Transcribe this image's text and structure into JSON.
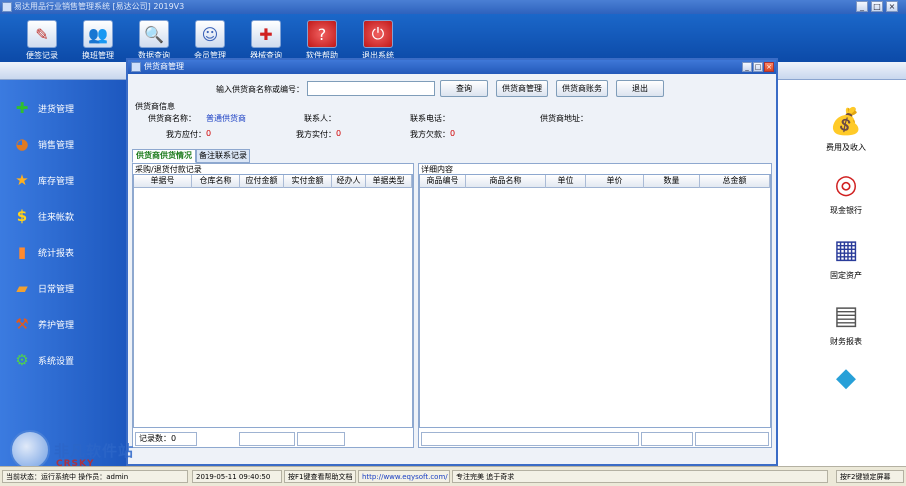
{
  "window": {
    "title": "易达用品行业销售管理系统 [易达公司] 2019V3",
    "controls": [
      "_",
      "□",
      "×"
    ]
  },
  "toolbar": [
    {
      "label": "便签记录",
      "icon": "notepad-icon"
    },
    {
      "label": "换班管理",
      "icon": "people-icon"
    },
    {
      "label": "数据查询",
      "icon": "magnifier-icon"
    },
    {
      "label": "会员管理",
      "icon": "members-icon"
    },
    {
      "label": "器械查询",
      "icon": "medical-kit-icon"
    },
    {
      "label": "软件帮助",
      "icon": "help-icon"
    },
    {
      "label": "退出系统",
      "icon": "power-icon"
    }
  ],
  "sidebar": [
    {
      "label": "进货管理",
      "icon": "plus-icon"
    },
    {
      "label": "销售管理",
      "icon": "pie-icon"
    },
    {
      "label": "库存管理",
      "icon": "star-icon"
    },
    {
      "label": "往来帐款",
      "icon": "dollar-icon"
    },
    {
      "label": "统计报表",
      "icon": "bar-chart-icon"
    },
    {
      "label": "日常管理",
      "icon": "folder-icon"
    },
    {
      "label": "养护管理",
      "icon": "tools-icon"
    },
    {
      "label": "系统设置",
      "icon": "gear-icon"
    }
  ],
  "rightbar": [
    {
      "label": "费用及收入",
      "icon": "money-bag-icon"
    },
    {
      "label": "现金银行",
      "icon": "coins-icon"
    },
    {
      "label": "固定资产",
      "icon": "building-icon"
    },
    {
      "label": "财务报表",
      "icon": "report-book-icon"
    },
    {
      "label": "",
      "icon": "cubes-icon"
    }
  ],
  "dialog": {
    "title": "供货商管理",
    "search_label": "输入供货商名称或编号：",
    "search_value": "",
    "buttons": [
      "查询",
      "供货商管理",
      "供货商账务",
      "退出"
    ],
    "info_header": "供货商信息",
    "info": {
      "name_label": "供货商名称：",
      "name_value": "普通供货商",
      "contact_label": "联系人：",
      "phone_label": "联系电话：",
      "address_label": "供货商地址：",
      "payable_label": "我方应付：",
      "payable_value": "0",
      "paid_label": "我方实付：",
      "paid_value": "0",
      "owed_label": "我方欠款：",
      "owed_value": "0"
    },
    "tabs": [
      "供货商供货情况",
      "备注联系记录"
    ],
    "left_panel": {
      "title": "采购/退货付款记录",
      "columns": [
        "单据号",
        "仓库名称",
        "应付金额",
        "实付金额",
        "经办人",
        "单据类型"
      ],
      "footer": "记录数：0"
    },
    "right_panel": {
      "title": "详细内容",
      "columns": [
        "商品编号",
        "商品名称",
        "单位",
        "单价",
        "数量",
        "总金额"
      ]
    }
  },
  "statusbar": {
    "user": "当前状态：运行系统中 操作员：admin",
    "datetime": "2019-05-11 09:40:50",
    "help": "按F1键查看帮助文档",
    "url": "http://www.eqysoft.com/",
    "slogan": "专注完美 追于奇求",
    "lock": "按F2键锁定屏幕"
  },
  "watermark": {
    "line1": "非凡软件站",
    "line2": "CRSKY"
  }
}
